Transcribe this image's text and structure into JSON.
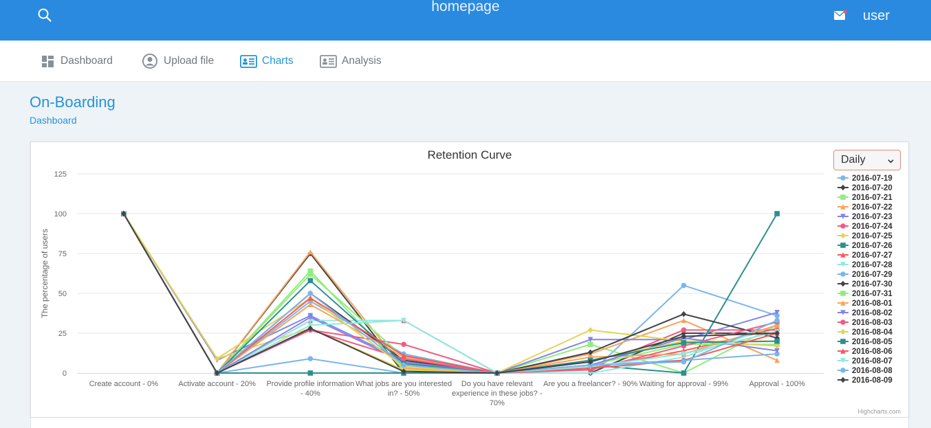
{
  "header": {
    "brand": "homepage",
    "user": "user",
    "icons": {
      "search": "search-icon",
      "mail": "mail-icon"
    }
  },
  "nav": {
    "items": [
      {
        "label": "Dashboard",
        "icon": "dashboard-icon",
        "active": false
      },
      {
        "label": "Upload file",
        "icon": "user-circle-icon",
        "active": false
      },
      {
        "label": "Charts",
        "icon": "id-card-icon",
        "active": true
      },
      {
        "label": "Analysis",
        "icon": "id-card-icon",
        "active": false
      }
    ]
  },
  "page": {
    "title": "On-Boarding",
    "breadcrumb": "Dashboard"
  },
  "controls": {
    "period": "Daily",
    "period_options": [
      "Daily"
    ]
  },
  "chart_data": {
    "type": "line",
    "title": "Retention Curve",
    "xlabel": "",
    "ylabel": "The percentage of users",
    "ylim": [
      0,
      125
    ],
    "yticks": [
      0,
      25,
      50,
      75,
      100,
      125
    ],
    "grid": true,
    "legend_position": "right",
    "credits": "Highcharts.com",
    "categories": [
      "Create account - 0%",
      "Activate account - 20%",
      "Provide profile information - 40%",
      "What jobs are you interested in? - 50%",
      "Do you have relevant experience in these jobs? - 70%",
      "Are you a freelancer? - 90%",
      "Waiting for approval - 99%",
      "Approval - 100%"
    ],
    "series": [
      {
        "name": "2016-07-19",
        "color": "#7cb5ec",
        "marker": "circle",
        "values": [
          100,
          0,
          9,
          0,
          0,
          0,
          55,
          36
        ]
      },
      {
        "name": "2016-07-20",
        "color": "#434348",
        "marker": "diamond",
        "values": [
          100,
          0,
          75,
          0,
          0,
          0,
          25,
          25
        ]
      },
      {
        "name": "2016-07-21",
        "color": "#90ed7d",
        "marker": "square",
        "values": [
          100,
          0,
          64,
          2,
          0,
          18,
          0,
          30
        ]
      },
      {
        "name": "2016-07-22",
        "color": "#f7a35c",
        "marker": "triangle",
        "values": [
          100,
          0,
          76,
          3,
          0,
          12,
          33,
          8
        ]
      },
      {
        "name": "2016-07-23",
        "color": "#8085e9",
        "marker": "triangle-down",
        "values": [
          100,
          8,
          36,
          8,
          0,
          21,
          21,
          38
        ]
      },
      {
        "name": "2016-07-24",
        "color": "#f15c80",
        "marker": "circle",
        "values": [
          100,
          0,
          27,
          18,
          0,
          3,
          27,
          27
        ]
      },
      {
        "name": "2016-07-25",
        "color": "#e4d354",
        "marker": "diamond",
        "values": [
          100,
          9,
          28,
          2,
          0,
          27,
          20,
          20
        ]
      },
      {
        "name": "2016-07-26",
        "color": "#2b908f",
        "marker": "square",
        "values": [
          100,
          0,
          0,
          0,
          0,
          5,
          0,
          100
        ]
      },
      {
        "name": "2016-07-27",
        "color": "#f45b5b",
        "marker": "triangle",
        "values": [
          100,
          0,
          33,
          33,
          0,
          3,
          14,
          28
        ]
      },
      {
        "name": "2016-07-28",
        "color": "#91e8e1",
        "marker": "triangle-down",
        "values": [
          100,
          0,
          33,
          33,
          0,
          0,
          10,
          30
        ]
      },
      {
        "name": "2016-07-29",
        "color": "#7cb5ec",
        "marker": "circle",
        "values": [
          100,
          0,
          45,
          12,
          0,
          5,
          8,
          12
        ]
      },
      {
        "name": "2016-07-30",
        "color": "#434348",
        "marker": "diamond",
        "values": [
          100,
          0,
          50,
          8,
          0,
          13,
          37,
          22
        ]
      },
      {
        "name": "2016-07-31",
        "color": "#90ed7d",
        "marker": "square",
        "values": [
          100,
          0,
          62,
          10,
          0,
          5,
          18,
          18
        ]
      },
      {
        "name": "2016-08-01",
        "color": "#f7a35c",
        "marker": "triangle",
        "values": [
          100,
          0,
          43,
          10,
          0,
          10,
          12,
          30
        ]
      },
      {
        "name": "2016-08-02",
        "color": "#8085e9",
        "marker": "triangle-down",
        "values": [
          100,
          0,
          35,
          7,
          0,
          5,
          22,
          14
        ]
      },
      {
        "name": "2016-08-03",
        "color": "#f15c80",
        "marker": "circle",
        "values": [
          100,
          0,
          27,
          9,
          0,
          2,
          17,
          32
        ]
      },
      {
        "name": "2016-08-04",
        "color": "#e4d354",
        "marker": "diamond",
        "values": [
          100,
          9,
          47,
          4,
          0,
          8,
          20,
          17
        ]
      },
      {
        "name": "2016-08-05",
        "color": "#2b908f",
        "marker": "square",
        "values": [
          100,
          0,
          58,
          6,
          0,
          8,
          19,
          20
        ]
      },
      {
        "name": "2016-08-06",
        "color": "#f45b5b",
        "marker": "triangle",
        "values": [
          100,
          0,
          47,
          11,
          0,
          3,
          8,
          25
        ]
      },
      {
        "name": "2016-08-07",
        "color": "#91e8e1",
        "marker": "triangle-down",
        "values": [
          100,
          0,
          30,
          33,
          0,
          4,
          12,
          26
        ]
      },
      {
        "name": "2016-08-08",
        "color": "#7cb5ec",
        "marker": "circle",
        "values": [
          100,
          0,
          50,
          5,
          0,
          5,
          7,
          33
        ]
      },
      {
        "name": "2016-08-09",
        "color": "#434348",
        "marker": "diamond",
        "values": [
          100,
          0,
          28,
          1,
          0,
          7,
          23,
          25
        ]
      }
    ]
  }
}
